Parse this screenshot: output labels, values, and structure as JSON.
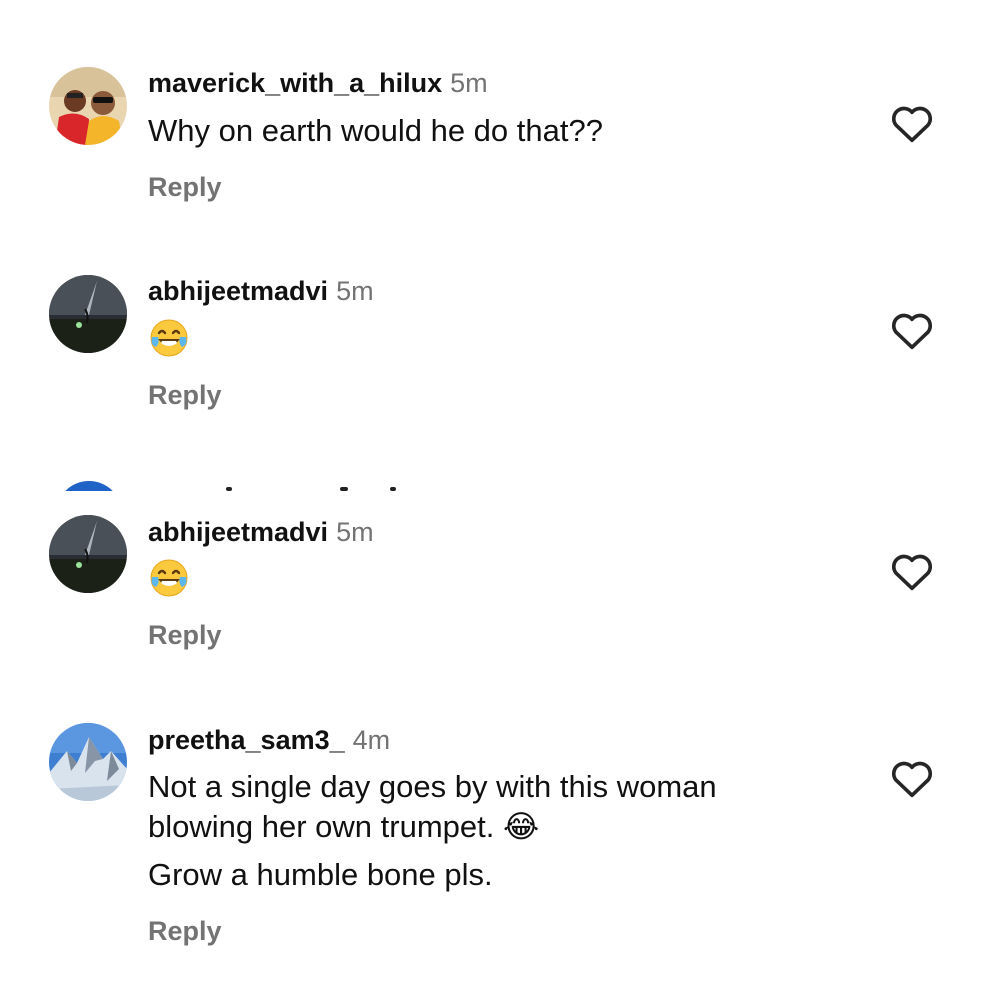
{
  "comments": [
    {
      "username": "maverick_with_a_hilux",
      "time": "5m",
      "lines": [
        "Why on earth would he do that??"
      ],
      "reply_label": "Reply",
      "avatar_icon": "two-people-avatar"
    },
    {
      "username": "abhijeetmadvi",
      "time": "5m",
      "lines": [
        "😂"
      ],
      "reply_label": "Reply",
      "avatar_icon": "night-sky-avatar"
    },
    {
      "username": "abhijeetmadvi",
      "time": "5m",
      "lines": [
        "😂"
      ],
      "reply_label": "Reply",
      "avatar_icon": "night-sky-avatar"
    },
    {
      "username": "preetha_sam3_",
      "time": "4m",
      "lines": [
        "Not a single day goes by with this woman",
        "blowing her own trumpet. 😂",
        "Grow a humble bone pls."
      ],
      "reply_label": "Reply",
      "avatar_icon": "mountain-avatar"
    }
  ],
  "icons": {
    "like": "heart-outline-icon",
    "emoji": "face-with-tears-of-joy-emoji"
  },
  "colors": {
    "text": "#111111",
    "secondary_text": "#737373",
    "background": "#ffffff",
    "partial_avatar": "#1f63c6"
  }
}
